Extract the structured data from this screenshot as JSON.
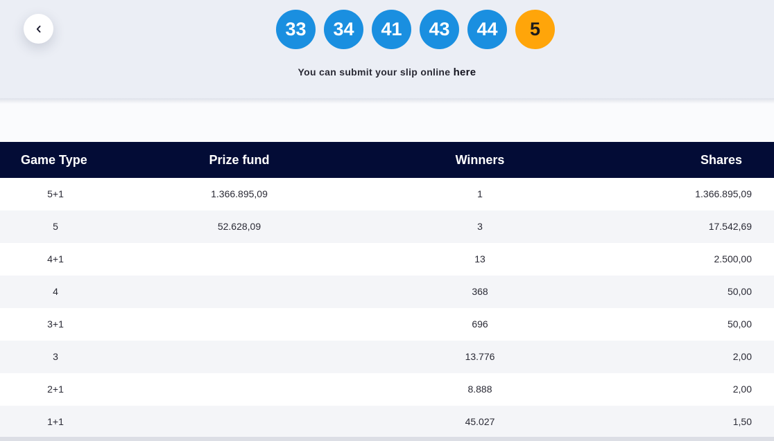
{
  "draw": {
    "balls": [
      "33",
      "34",
      "41",
      "43",
      "44"
    ],
    "bonus_ball": "5",
    "submit_text": "You can submit your slip online ",
    "submit_link": "here"
  },
  "colors": {
    "ball": "#1a8fe0",
    "bonus_ball": "#ffa50a",
    "table_header": "#030c36"
  },
  "icons": {
    "back": "chevron-left-icon"
  },
  "table": {
    "headers": {
      "game_type": "Game Type",
      "prize_fund": "Prize fund",
      "winners": "Winners",
      "shares": "Shares"
    },
    "rows": [
      {
        "game_type": "5+1",
        "prize_fund": "1.366.895,09",
        "winners": "1",
        "shares": "1.366.895,09"
      },
      {
        "game_type": "5",
        "prize_fund": "52.628,09",
        "winners": "3",
        "shares": "17.542,69"
      },
      {
        "game_type": "4+1",
        "prize_fund": "",
        "winners": "13",
        "shares": "2.500,00"
      },
      {
        "game_type": "4",
        "prize_fund": "",
        "winners": "368",
        "shares": "50,00"
      },
      {
        "game_type": "3+1",
        "prize_fund": "",
        "winners": "696",
        "shares": "50,00"
      },
      {
        "game_type": "3",
        "prize_fund": "",
        "winners": "13.776",
        "shares": "2,00"
      },
      {
        "game_type": "2+1",
        "prize_fund": "",
        "winners": "8.888",
        "shares": "2,00"
      },
      {
        "game_type": "1+1",
        "prize_fund": "",
        "winners": "45.027",
        "shares": "1,50"
      }
    ]
  }
}
